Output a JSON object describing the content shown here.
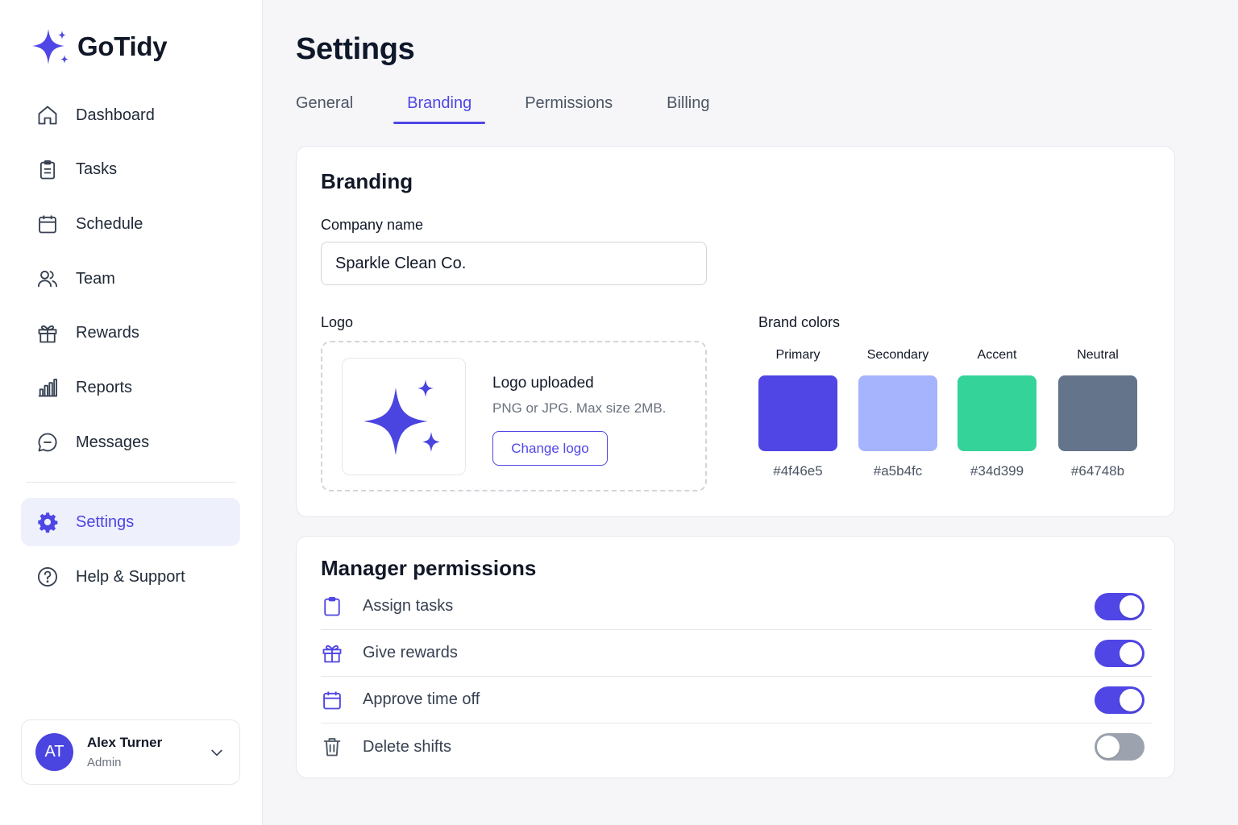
{
  "app": {
    "name": "GoTidy",
    "logo_icon": "sparkle-icon"
  },
  "sidebar": {
    "items": [
      {
        "label": "Dashboard",
        "icon": "home-icon"
      },
      {
        "label": "Tasks",
        "icon": "clipboard-icon"
      },
      {
        "label": "Schedule",
        "icon": "calendar-icon"
      },
      {
        "label": "Team",
        "icon": "users-icon"
      },
      {
        "label": "Rewards",
        "icon": "gift-icon"
      },
      {
        "label": "Reports",
        "icon": "bar-chart-icon"
      },
      {
        "label": "Messages",
        "icon": "message-icon"
      }
    ],
    "bottom_items": [
      {
        "label": "Settings",
        "icon": "gear-icon",
        "active": true
      },
      {
        "label": "Help & Support",
        "icon": "help-icon"
      }
    ],
    "user": {
      "initials": "AT",
      "name": "Alex Turner",
      "role": "Admin"
    }
  },
  "page": {
    "title": "Settings",
    "tabs": [
      {
        "label": "General"
      },
      {
        "label": "Branding",
        "active": true
      },
      {
        "label": "Permissions"
      },
      {
        "label": "Billing"
      }
    ]
  },
  "branding": {
    "title": "Branding",
    "company_label": "Company name",
    "company_value": "Sparkle Clean Co.",
    "logo_label": "Logo",
    "logo_status": "Logo uploaded",
    "logo_hint": "PNG or JPG. Max size 2MB.",
    "change_logo": "Change logo",
    "colors_label": "Brand colors",
    "colors": [
      {
        "name": "Primary",
        "hex": "#4f46e5"
      },
      {
        "name": "Secondary",
        "hex": "#a5b4fc"
      },
      {
        "name": "Accent",
        "hex": "#34d399"
      },
      {
        "name": "Neutral",
        "hex": "#64748b"
      }
    ]
  },
  "permissions": {
    "title": "Manager permissions",
    "items": [
      {
        "label": "Assign tasks",
        "icon": "clipboard-icon",
        "enabled": true
      },
      {
        "label": "Give rewards",
        "icon": "gift-icon",
        "enabled": true
      },
      {
        "label": "Approve time off",
        "icon": "calendar-icon",
        "enabled": true
      },
      {
        "label": "Delete shifts",
        "icon": "trash-icon",
        "enabled": false
      }
    ]
  },
  "theme": {
    "accent": "#4f46e5",
    "toggle_off": "#9ca3af",
    "active_bg": "#eef0fc"
  }
}
